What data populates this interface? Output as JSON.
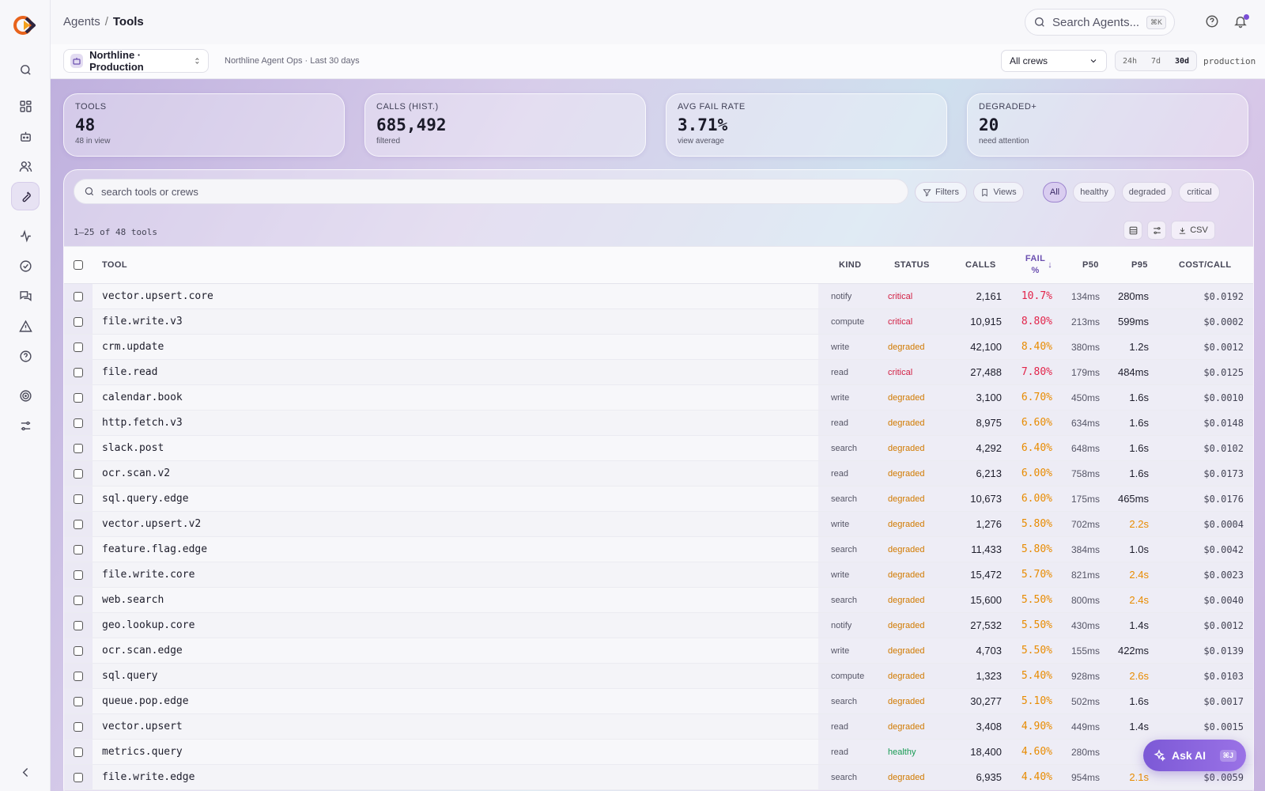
{
  "breadcrumb": {
    "root": "Agents",
    "sep": "/",
    "current": "Tools"
  },
  "search": {
    "placeholder": "Search Agents...",
    "shortcut": "⌘K"
  },
  "context": {
    "project": "Northline · Production",
    "subtitle": "Northline Agent Ops · Last 30 days",
    "crew_select": "All crews",
    "ranges": [
      "24h",
      "7d",
      "30d"
    ],
    "active_range": "30d",
    "environment": "production"
  },
  "kpis": [
    {
      "label": "TOOLS",
      "value": "48",
      "sub": "48 in view"
    },
    {
      "label": "CALLS (HIST.)",
      "value": "685,492",
      "sub": "filtered"
    },
    {
      "label": "AVG FAIL RATE",
      "value": "3.71%",
      "sub": "view average"
    },
    {
      "label": "DEGRADED+",
      "value": "20",
      "sub": "need attention"
    }
  ],
  "toolbar": {
    "search_placeholder": "search tools or crews",
    "filters": "Filters",
    "views": "Views",
    "status_chips": [
      "All",
      "healthy",
      "degraded",
      "critical"
    ],
    "count_text": "1–25 of 48 tools",
    "csv": "CSV"
  },
  "table": {
    "headers": {
      "tool": "TOOL",
      "kind": "KIND",
      "status": "STATUS",
      "calls": "CALLS",
      "fail_line1": "FAIL",
      "fail_line2": "%",
      "sort_arrow": "↓",
      "p50": "P50",
      "p95": "P95",
      "cost": "COST/CALL"
    },
    "rows": [
      {
        "tool": "vector.upsert.core",
        "kind": "notify",
        "status": "critical",
        "calls": "2,161",
        "fail": "10.7%",
        "p50": "134ms",
        "p95": "280ms",
        "cost": "$0.0192"
      },
      {
        "tool": "file.write.v3",
        "kind": "compute",
        "status": "critical",
        "calls": "10,915",
        "fail": "8.80%",
        "p50": "213ms",
        "p95": "599ms",
        "cost": "$0.0002"
      },
      {
        "tool": "crm.update",
        "kind": "write",
        "status": "degraded",
        "calls": "42,100",
        "fail": "8.40%",
        "p50": "380ms",
        "p95": "1.2s",
        "cost": "$0.0012"
      },
      {
        "tool": "file.read",
        "kind": "read",
        "status": "critical",
        "calls": "27,488",
        "fail": "7.80%",
        "p50": "179ms",
        "p95": "484ms",
        "cost": "$0.0125"
      },
      {
        "tool": "calendar.book",
        "kind": "write",
        "status": "degraded",
        "calls": "3,100",
        "fail": "6.70%",
        "p50": "450ms",
        "p95": "1.6s",
        "cost": "$0.0010"
      },
      {
        "tool": "http.fetch.v3",
        "kind": "read",
        "status": "degraded",
        "calls": "8,975",
        "fail": "6.60%",
        "p50": "634ms",
        "p95": "1.6s",
        "cost": "$0.0148"
      },
      {
        "tool": "slack.post",
        "kind": "search",
        "status": "degraded",
        "calls": "4,292",
        "fail": "6.40%",
        "p50": "648ms",
        "p95": "1.6s",
        "cost": "$0.0102"
      },
      {
        "tool": "ocr.scan.v2",
        "kind": "read",
        "status": "degraded",
        "calls": "6,213",
        "fail": "6.00%",
        "p50": "758ms",
        "p95": "1.6s",
        "cost": "$0.0173"
      },
      {
        "tool": "sql.query.edge",
        "kind": "search",
        "status": "degraded",
        "calls": "10,673",
        "fail": "6.00%",
        "p50": "175ms",
        "p95": "465ms",
        "cost": "$0.0176"
      },
      {
        "tool": "vector.upsert.v2",
        "kind": "write",
        "status": "degraded",
        "calls": "1,276",
        "fail": "5.80%",
        "p50": "702ms",
        "p95": "2.2s",
        "cost": "$0.0004"
      },
      {
        "tool": "feature.flag.edge",
        "kind": "search",
        "status": "degraded",
        "calls": "11,433",
        "fail": "5.80%",
        "p50": "384ms",
        "p95": "1.0s",
        "cost": "$0.0042"
      },
      {
        "tool": "file.write.core",
        "kind": "write",
        "status": "degraded",
        "calls": "15,472",
        "fail": "5.70%",
        "p50": "821ms",
        "p95": "2.4s",
        "cost": "$0.0023"
      },
      {
        "tool": "web.search",
        "kind": "search",
        "status": "degraded",
        "calls": "15,600",
        "fail": "5.50%",
        "p50": "800ms",
        "p95": "2.4s",
        "cost": "$0.0040"
      },
      {
        "tool": "geo.lookup.core",
        "kind": "notify",
        "status": "degraded",
        "calls": "27,532",
        "fail": "5.50%",
        "p50": "430ms",
        "p95": "1.4s",
        "cost": "$0.0012"
      },
      {
        "tool": "ocr.scan.edge",
        "kind": "write",
        "status": "degraded",
        "calls": "4,703",
        "fail": "5.50%",
        "p50": "155ms",
        "p95": "422ms",
        "cost": "$0.0139"
      },
      {
        "tool": "sql.query",
        "kind": "compute",
        "status": "degraded",
        "calls": "1,323",
        "fail": "5.40%",
        "p50": "928ms",
        "p95": "2.6s",
        "cost": "$0.0103"
      },
      {
        "tool": "queue.pop.edge",
        "kind": "search",
        "status": "degraded",
        "calls": "30,277",
        "fail": "5.10%",
        "p50": "502ms",
        "p95": "1.6s",
        "cost": "$0.0017"
      },
      {
        "tool": "vector.upsert",
        "kind": "read",
        "status": "degraded",
        "calls": "3,408",
        "fail": "4.90%",
        "p50": "449ms",
        "p95": "1.4s",
        "cost": "$0.0015"
      },
      {
        "tool": "metrics.query",
        "kind": "read",
        "status": "healthy",
        "calls": "18,400",
        "fail": "4.60%",
        "p50": "280ms",
        "p95": "",
        "cost": ""
      },
      {
        "tool": "file.write.edge",
        "kind": "search",
        "status": "degraded",
        "calls": "6,935",
        "fail": "4.40%",
        "p50": "954ms",
        "p95": "2.1s",
        "cost": "$0.0059"
      }
    ]
  },
  "ask_ai": {
    "label": "Ask AI",
    "shortcut": "⌘J"
  },
  "colors": {
    "accent": "#7c59d6",
    "critical": "#d21e42",
    "degraded": "#d17a00",
    "healthy": "#179a53"
  }
}
